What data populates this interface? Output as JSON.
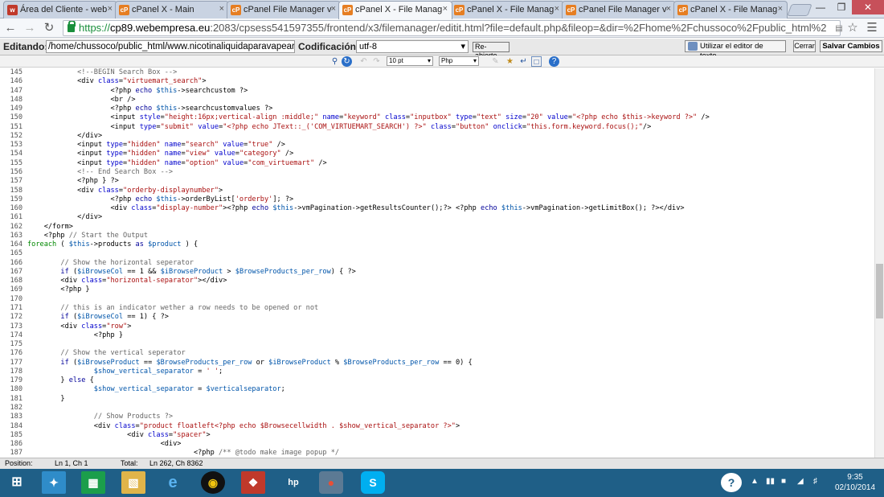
{
  "tabs": [
    {
      "label": "Área del Cliente - web",
      "fav": "w",
      "favcolor": "#c0392b",
      "active": false
    },
    {
      "label": "cPanel X - Main",
      "fav": "cP",
      "favcolor": "#e67e22",
      "active": false
    },
    {
      "label": "cPanel File Manager v",
      "fav": "cP",
      "favcolor": "#e67e22",
      "active": false
    },
    {
      "label": "cPanel X - File Manag",
      "fav": "cP",
      "favcolor": "#e67e22",
      "active": true
    },
    {
      "label": "cPanel X - File Manag",
      "fav": "cP",
      "favcolor": "#e67e22",
      "active": false
    },
    {
      "label": "cPanel File Manager v",
      "fav": "cP",
      "favcolor": "#e67e22",
      "active": false
    },
    {
      "label": "cPanel X - File Manag",
      "fav": "cP",
      "favcolor": "#e67e22",
      "active": false
    }
  ],
  "address": {
    "scheme": "https://",
    "host": "cp89.webempresa.eu",
    "path": ":2083/cpsess541597355/frontend/x3/filemanager/editit.html?file=default.php&fileop=&dir=%2Fhome%2Fchussoco%2Fpublic_html%2"
  },
  "editor": {
    "editing_label": "Editando:",
    "path_value": "/home/chussoco/public_html/www.nicotinaliquidaparavapear.com",
    "encoding_label": "Codificación:",
    "encoding_value": "utf-8",
    "reopen_label": "Re-abierto",
    "use_editor_label": "Utilizar el editor de texto.",
    "cancel_label": "Cerrar",
    "save_label": "Salvar Cambios"
  },
  "toolbar": {
    "font_size": "10 pt",
    "language": "Php"
  },
  "code_lines": [
    {
      "n": "145",
      "h": "            <span class='c'>&lt;!--BEGIN Search Box --&gt;</span>"
    },
    {
      "n": "146",
      "h": "            &lt;div <span class='a'>class</span>=<span class='s'>\"virtuemart_search\"</span>&gt;"
    },
    {
      "n": "147",
      "h": "                    &lt;?php <span class='k'>echo</span> <span class='v'>$this</span>-&gt;searchcustom ?&gt;"
    },
    {
      "n": "148",
      "h": "                    &lt;br /&gt;"
    },
    {
      "n": "149",
      "h": "                    &lt;?php <span class='k'>echo</span> <span class='v'>$this</span>-&gt;searchcustomvalues ?&gt;"
    },
    {
      "n": "150",
      "h": "                    &lt;input <span class='a'>style</span>=<span class='s'>\"height:16px;vertical-align :middle;\"</span> <span class='a'>name</span>=<span class='s'>\"keyword\"</span> <span class='a'>class</span>=<span class='s'>\"inputbox\"</span> <span class='a'>type</span>=<span class='s'>\"text\"</span> <span class='a'>size</span>=<span class='s'>\"20\"</span> <span class='a'>value</span>=<span class='s'>\"&lt;?php echo $this-&gt;keyword ?&gt;\"</span> /&gt;"
    },
    {
      "n": "151",
      "h": "                    &lt;input <span class='a'>type</span>=<span class='s'>\"submit\"</span> <span class='a'>value</span>=<span class='s'>\"&lt;?php echo JText::_('COM_VIRTUEMART_SEARCH') ?&gt;\"</span> <span class='a'>class</span>=<span class='s'>\"button\"</span> <span class='a'>onclick</span>=<span class='s'>\"this.form.keyword.focus();\"</span>/&gt;"
    },
    {
      "n": "152",
      "h": "            &lt;/div&gt;"
    },
    {
      "n": "153",
      "h": "            &lt;input <span class='a'>type</span>=<span class='s'>\"hidden\"</span> <span class='a'>name</span>=<span class='s'>\"search\"</span> <span class='a'>value</span>=<span class='s'>\"true\"</span> /&gt;"
    },
    {
      "n": "154",
      "h": "            &lt;input <span class='a'>type</span>=<span class='s'>\"hidden\"</span> <span class='a'>name</span>=<span class='s'>\"view\"</span> <span class='a'>value</span>=<span class='s'>\"category\"</span> /&gt;"
    },
    {
      "n": "155",
      "h": "            &lt;input <span class='a'>type</span>=<span class='s'>\"hidden\"</span> <span class='a'>name</span>=<span class='s'>\"option\"</span> <span class='a'>value</span>=<span class='s'>\"com_virtuemart\"</span> /&gt;"
    },
    {
      "n": "156",
      "h": "            <span class='c'>&lt;!-- End Search Box --&gt;</span>"
    },
    {
      "n": "157",
      "h": "            &lt;?php } ?&gt;"
    },
    {
      "n": "158",
      "h": "            &lt;div <span class='a'>class</span>=<span class='s'>\"orderby-displaynumber\"</span>&gt;"
    },
    {
      "n": "159",
      "h": "                    &lt;?php <span class='k'>echo</span> <span class='v'>$this</span>-&gt;orderByList[<span class='s'>'orderby'</span>]; ?&gt;"
    },
    {
      "n": "160",
      "h": "                    &lt;div <span class='a'>class</span>=<span class='s'>\"display-number\"</span>&gt;&lt;?php <span class='k'>echo</span> <span class='v'>$this</span>-&gt;vmPagination-&gt;getResultsCounter();?&gt; &lt;?php <span class='k'>echo</span> <span class='v'>$this</span>-&gt;vmPagination-&gt;getLimitBox(); ?&gt;&lt;/div&gt;"
    },
    {
      "n": "161",
      "h": "            &lt;/div&gt;"
    },
    {
      "n": "162",
      "h": "    &lt;/form&gt;"
    },
    {
      "n": "163",
      "h": "    &lt;?php <span class='c'>// Start the Output</span>"
    },
    {
      "n": "164",
      "h": "<span class='t'>foreach</span> ( <span class='v'>$this</span>-&gt;products <span class='k'>as</span> <span class='v'>$product</span> ) {"
    },
    {
      "n": "165",
      "h": ""
    },
    {
      "n": "166",
      "h": "        <span class='c'>// Show the horizontal seperator</span>"
    },
    {
      "n": "167",
      "h": "        <span class='k'>if</span> (<span class='v'>$iBrowseCol</span> == 1 &amp;&amp; <span class='v'>$iBrowseProduct</span> &gt; <span class='v'>$BrowseProducts_per_row</span>) { ?&gt;"
    },
    {
      "n": "168",
      "h": "        &lt;div <span class='a'>class</span>=<span class='s'>\"horizontal-separator\"</span>&gt;&lt;/div&gt;"
    },
    {
      "n": "169",
      "h": "        &lt;?php }"
    },
    {
      "n": "170",
      "h": ""
    },
    {
      "n": "171",
      "h": "        <span class='c'>// this is an indicator wether a row needs to be opened or not</span>"
    },
    {
      "n": "172",
      "h": "        <span class='k'>if</span> (<span class='v'>$iBrowseCol</span> == 1) { ?&gt;"
    },
    {
      "n": "173",
      "h": "        &lt;div <span class='a'>class</span>=<span class='s'>\"row\"</span>&gt;"
    },
    {
      "n": "174",
      "h": "                &lt;?php }"
    },
    {
      "n": "175",
      "h": ""
    },
    {
      "n": "176",
      "h": "        <span class='c'>// Show the vertical seperator</span>"
    },
    {
      "n": "177",
      "h": "        <span class='k'>if</span> (<span class='v'>$iBrowseProduct</span> == <span class='v'>$BrowseProducts_per_row</span> or <span class='v'>$iBrowseProduct</span> % <span class='v'>$BrowseProducts_per_row</span> == 0) {"
    },
    {
      "n": "178",
      "h": "                <span class='v'>$show_vertical_separator</span> = <span class='s'>' '</span>;"
    },
    {
      "n": "179",
      "h": "        } <span class='k'>else</span> {"
    },
    {
      "n": "180",
      "h": "                <span class='v'>$show_vertical_separator</span> = <span class='v'>$verticalseparator</span>;"
    },
    {
      "n": "181",
      "h": "        }"
    },
    {
      "n": "182",
      "h": ""
    },
    {
      "n": "183",
      "h": "                <span class='c'>// Show Products ?&gt;</span>"
    },
    {
      "n": "184",
      "h": "                &lt;div <span class='a'>class</span>=<span class='s'>\"product floatleft&lt;?php echo $Browsecellwidth . $show_vertical_separator ?&gt;\"</span>&gt;"
    },
    {
      "n": "185",
      "h": "                        &lt;div <span class='a'>class</span>=<span class='s'>\"spacer\"</span>&gt;"
    },
    {
      "n": "186",
      "h": "                                &lt;div&gt;"
    },
    {
      "n": "187",
      "h": "                                        &lt;?php <span class='c'>/** @todo make image popup */</span>"
    }
  ],
  "status": {
    "position_label": "Position:",
    "position_value": "Ln 1, Ch 1",
    "total_label": "Total:",
    "total_value": "Ln 262, Ch 8362"
  },
  "clock": {
    "time": "9:35",
    "date": "02/10/2014"
  }
}
